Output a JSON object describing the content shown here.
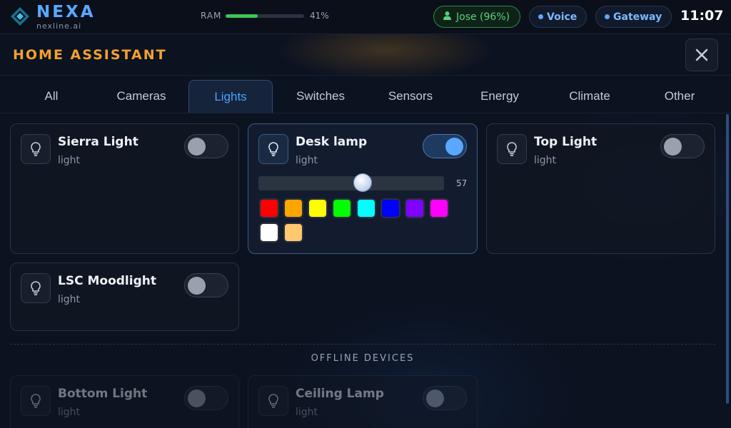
{
  "topbar": {
    "brand": "NEXA",
    "brand_sub": "nexline.ai",
    "ram_label": "RAM",
    "ram_percent_text": "41%",
    "ram_fraction": 0.41,
    "user_label": "Jose (96%)",
    "voice_label": "Voice",
    "gateway_label": "Gateway",
    "clock": "11:07"
  },
  "header": {
    "title": "HOME ASSISTANT"
  },
  "tabs": [
    {
      "label": "All"
    },
    {
      "label": "Cameras"
    },
    {
      "label": "Lights"
    },
    {
      "label": "Switches"
    },
    {
      "label": "Sensors"
    },
    {
      "label": "Energy"
    },
    {
      "label": "Climate"
    },
    {
      "label": "Other"
    }
  ],
  "active_tab": "Lights",
  "devices": [
    {
      "name": "Sierra Light",
      "type": "light",
      "on": false
    },
    {
      "name": "Desk lamp",
      "type": "light",
      "on": true,
      "brightness": 57,
      "brightness_text": "57",
      "colors": [
        "#ff0000",
        "#ffa500",
        "#ffff00",
        "#00ff00",
        "#00ffff",
        "#0000ff",
        "#8000ff",
        "#ff00ff",
        "#ffffff",
        "#ffc870"
      ]
    },
    {
      "name": "Top Light",
      "type": "light",
      "on": false
    },
    {
      "name": "LSC Moodlight",
      "type": "light",
      "on": false
    }
  ],
  "offline_label": "OFFLINE DEVICES",
  "offline_devices": [
    {
      "name": "Bottom Light",
      "type": "light",
      "on": false
    },
    {
      "name": "Ceiling Lamp",
      "type": "light",
      "on": false
    }
  ],
  "icons": {
    "logo": "diamond-logo-icon",
    "user": "user-icon",
    "close": "close-icon",
    "device": "lightbulb-icon"
  },
  "colors": {
    "accent": "#5aa8ff",
    "title_orange": "#f5a030",
    "status_green": "#5ad27a"
  }
}
